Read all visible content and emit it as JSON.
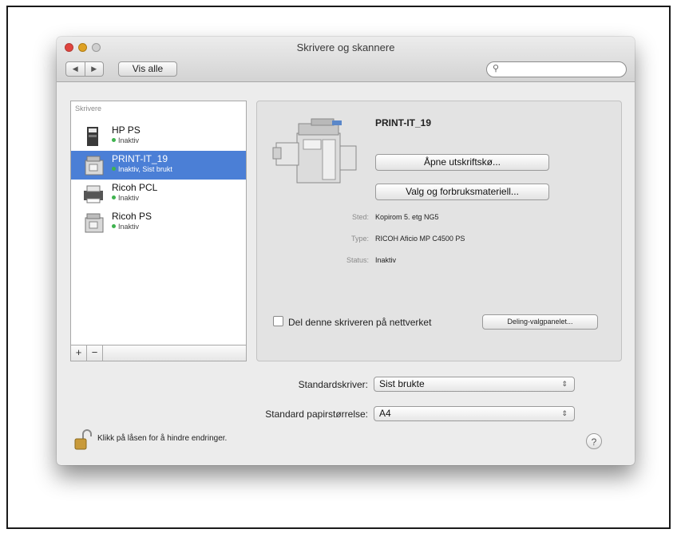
{
  "window": {
    "title": "Skrivere og skannere"
  },
  "toolbar": {
    "back": "◀",
    "forward": "▶",
    "show_all": "Vis alle",
    "search_placeholder": ""
  },
  "list": {
    "header": "Skrivere",
    "items": [
      {
        "name": "HP PS",
        "status": "Inaktiv",
        "icon": "printer-icon",
        "selected": false
      },
      {
        "name": "PRINT-IT_19",
        "status": "Inaktiv, Sist brukt",
        "icon": "copier-icon",
        "selected": true
      },
      {
        "name": "Ricoh PCL",
        "status": "Inaktiv",
        "icon": "printer-icon",
        "selected": false
      },
      {
        "name": "Ricoh PS",
        "status": "Inaktiv",
        "icon": "copier-icon",
        "selected": false
      }
    ],
    "add": "+",
    "remove": "−"
  },
  "detail": {
    "name": "PRINT-IT_19",
    "open_queue": "Åpne utskriftskø...",
    "options": "Valg og forbruksmateriell...",
    "location_label": "Sted:",
    "location": "Kopirom 5. etg NG5",
    "type_label": "Type:",
    "type": "RICOH Aficio MP C4500 PS",
    "status_label": "Status:",
    "status": "Inaktiv",
    "share_label": "Del denne skriveren på nettverket",
    "share_prefs": "Deling-valgpanelet..."
  },
  "defaults": {
    "printer_label": "Standardskriver:",
    "printer_value": "Sist brukte",
    "paper_label": "Standard papirstørrelse:",
    "paper_value": "A4",
    "arrows": "⇕"
  },
  "footer": {
    "lock_text": "Klikk på låsen for å hindre endringer.",
    "help": "?"
  },
  "colors": {
    "selection": "#4b7fd6",
    "status_dot": "#3fb34f"
  }
}
